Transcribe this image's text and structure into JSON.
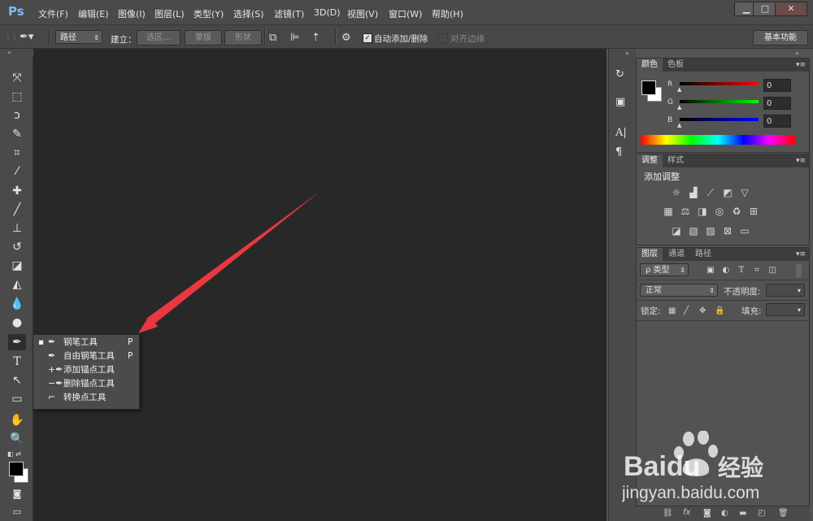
{
  "app": {
    "logo": "Ps"
  },
  "menu": [
    "文件(F)",
    "编辑(E)",
    "图像(I)",
    "图层(L)",
    "类型(Y)",
    "选择(S)",
    "滤镜(T)",
    "3D(D)",
    "视图(V)",
    "窗口(W)",
    "帮助(H)"
  ],
  "window_controls": {
    "minimize": "▁",
    "maximize": "□",
    "close": "✕"
  },
  "options": {
    "mode_value": "路径",
    "build_label": "建立：",
    "selection_btn": "选区...",
    "mask_btn": "蒙版",
    "shape_btn": "形状",
    "auto_add_delete": "自动添加/删除",
    "align_edges": "对齐边缘",
    "workspace": "基本功能"
  },
  "flyout": [
    {
      "label": "钢笔工具",
      "key": "P",
      "selected": true
    },
    {
      "label": "自由钢笔工具",
      "key": "P",
      "selected": false
    },
    {
      "label": "添加锚点工具",
      "key": "",
      "selected": false
    },
    {
      "label": "删除锚点工具",
      "key": "",
      "selected": false
    },
    {
      "label": "转换点工具",
      "key": "",
      "selected": false
    }
  ],
  "color_panel": {
    "tabs": [
      "颜色",
      "色板"
    ],
    "r_label": "R",
    "g_label": "G",
    "b_label": "B",
    "r_value": "0",
    "g_value": "0",
    "b_value": "0"
  },
  "adjust_panel": {
    "tabs": [
      "调整",
      "样式"
    ],
    "title": "添加调整"
  },
  "layers_panel": {
    "tabs": [
      "图层",
      "通道",
      "路径"
    ],
    "filter": "ρ 类型",
    "blend_mode": "正常",
    "opacity_label": "不透明度:",
    "lock_label": "锁定:",
    "fill_label": "填充:"
  },
  "watermark": {
    "brand": "Baidu",
    "brand_cn": "经验",
    "url": "jingyan.baidu.com"
  },
  "colors": {
    "accent": "#7fb7ff",
    "canvas": "#282828",
    "arrow": "#e8393e"
  }
}
